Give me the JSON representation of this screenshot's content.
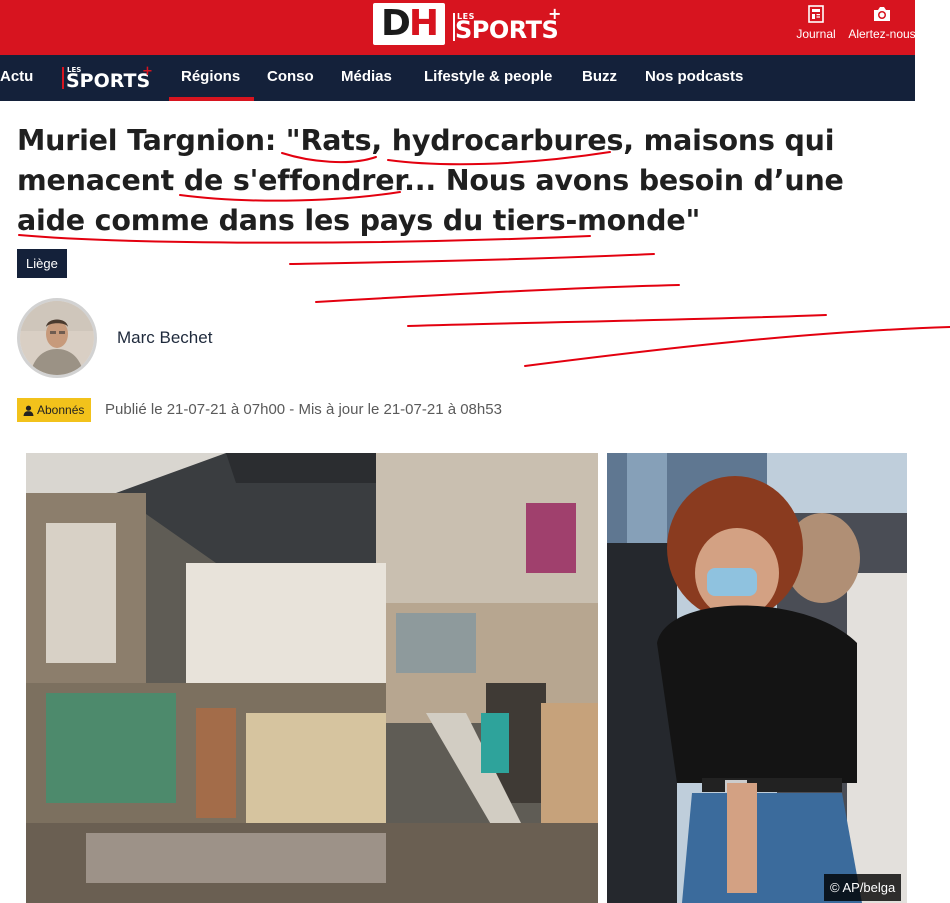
{
  "header": {
    "logo_dh": "DH",
    "logo_les": "LES",
    "logo_sports": "SPORTS",
    "logo_plus": "+",
    "journal_label": "Journal",
    "alert_label": "Alertez-nous",
    "journal_icon": "newspaper-icon",
    "alert_icon": "camera-icon",
    "brand_red": "#d7141f"
  },
  "nav": {
    "bg_color": "#14213a",
    "items": [
      {
        "label": "Actu"
      },
      {
        "label": "Régions",
        "active": true
      },
      {
        "label": "Conso"
      },
      {
        "label": "Médias"
      },
      {
        "label": "Lifestyle & people"
      },
      {
        "label": "Buzz"
      },
      {
        "label": "Nos podcasts"
      }
    ],
    "logo_les": "LES",
    "logo_sports": "SPORTS",
    "logo_plus": "+"
  },
  "article": {
    "title": "Muriel Targnion: \"Rats, hydrocarbures, maisons qui menacent de s'effondrer... Nous avons besoin d’une aide comme dans les pays du tiers-monde\"",
    "category": "Liège",
    "author": "Marc Bechet",
    "badge": "Abonnés",
    "published": "Publié le 21-07-21 à 07h00 - Mis à jour le 21-07-21 à 08h53",
    "photo_credit": "© AP/belga"
  },
  "annotation_color": "#e3000f"
}
